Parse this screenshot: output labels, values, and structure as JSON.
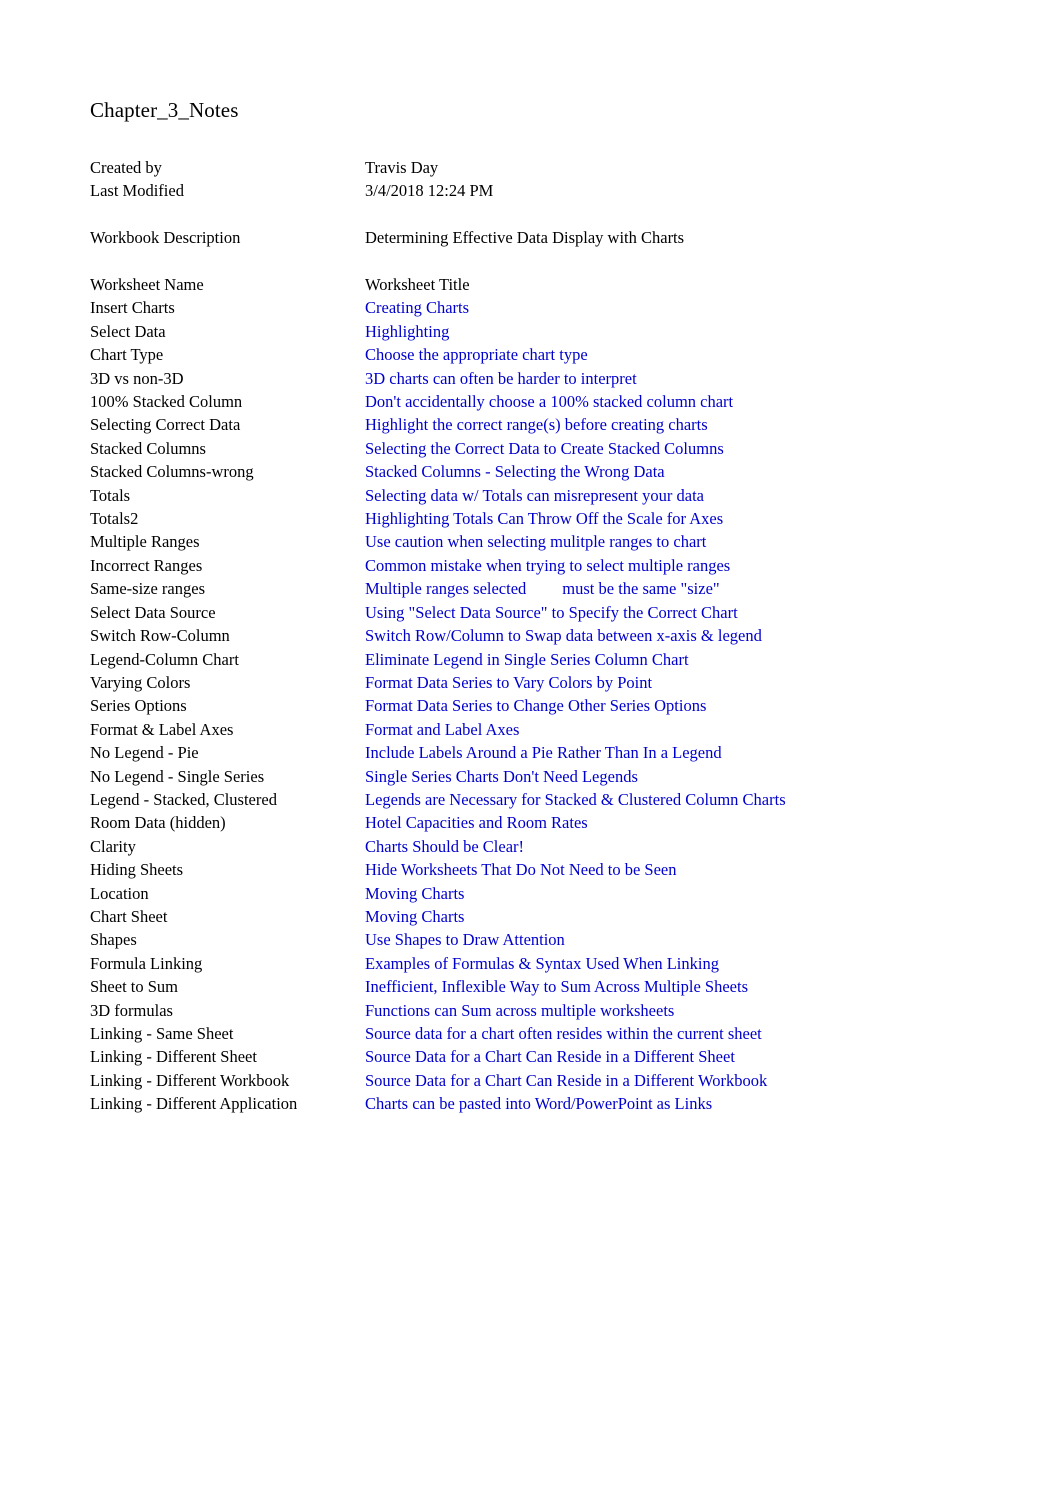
{
  "document": {
    "title": "Chapter_3_Notes",
    "metadata": [
      {
        "label": "Created by",
        "value": "Travis Day"
      },
      {
        "label": "Last Modified",
        "value": "3/4/2018 12:24 PM"
      }
    ],
    "description": {
      "label": "Workbook Description",
      "value": "Determining Effective Data Display with Charts"
    },
    "table": {
      "headers": {
        "name": "Worksheet Name",
        "title": "Worksheet Title"
      },
      "rows": [
        {
          "name": "Insert Charts",
          "title": "Creating Charts"
        },
        {
          "name": "Select Data",
          "title": "Highlighting"
        },
        {
          "name": "Chart Type",
          "title": "Choose the appropriate chart type"
        },
        {
          "name": "3D vs non-3D",
          "title": "3D charts can often be harder to interpret"
        },
        {
          "name": "100% Stacked Column",
          "title": "Don't accidentally choose a 100% stacked column chart"
        },
        {
          "name": "Selecting Correct Data",
          "title": "Highlight the correct range(s) before creating charts"
        },
        {
          "name": "Stacked Columns",
          "title": "Selecting the Correct Data to Create Stacked Columns"
        },
        {
          "name": "Stacked Columns-wrong",
          "title": "Stacked Columns - Selecting the Wrong Data"
        },
        {
          "name": "Totals",
          "title": "Selecting data w/ Totals can misrepresent your data"
        },
        {
          "name": "Totals2",
          "title": "Highlighting Totals Can Throw Off the Scale for Axes"
        },
        {
          "name": "Multiple Ranges",
          "title": "Use caution when selecting mulitple ranges to chart"
        },
        {
          "name": "Incorrect Ranges",
          "title": "Common mistake when trying to select multiple ranges"
        },
        {
          "name": "Same-size ranges",
          "title": "Multiple ranges selected",
          "title_tail": "must be the same \"size\""
        },
        {
          "name": "Select Data Source",
          "title": "Using \"Select Data Source\" to Specify the Correct Chart"
        },
        {
          "name": "Switch Row-Column",
          "title": "Switch Row/Column to Swap data between x-axis & legend"
        },
        {
          "name": "Legend-Column Chart",
          "title": "Eliminate Legend in Single Series Column Chart"
        },
        {
          "name": "Varying Colors",
          "title": "Format Data Series to Vary Colors by Point"
        },
        {
          "name": "Series Options",
          "title": "Format Data Series to Change Other Series Options"
        },
        {
          "name": "Format & Label Axes",
          "title": "Format and Label Axes"
        },
        {
          "name": "No Legend - Pie",
          "title": "Include Labels Around a Pie Rather Than In a Legend"
        },
        {
          "name": "No Legend - Single Series",
          "title": "Single Series Charts Don't Need Legends"
        },
        {
          "name": "Legend - Stacked, Clustered",
          "title": "Legends are Necessary for Stacked & Clustered Column Charts"
        },
        {
          "name": "Room Data (hidden)",
          "title": "Hotel Capacities and Room Rates"
        },
        {
          "name": "Clarity",
          "title": "Charts Should be Clear!"
        },
        {
          "name": "Hiding Sheets",
          "title": "Hide Worksheets That Do Not Need to be Seen"
        },
        {
          "name": "Location",
          "title": "Moving Charts"
        },
        {
          "name": "Chart Sheet",
          "title": "Moving Charts"
        },
        {
          "name": "Shapes",
          "title": "Use Shapes to Draw Attention"
        },
        {
          "name": "Formula Linking",
          "title": "Examples of Formulas & Syntax Used When Linking"
        },
        {
          "name": "Sheet to Sum",
          "title": "Inefficient, Inflexible Way to Sum Across Multiple Sheets"
        },
        {
          "name": "3D formulas",
          "title": "Functions can Sum across multiple worksheets"
        },
        {
          "name": "Linking - Same Sheet",
          "title": "Source data for a chart often resides within the current sheet"
        },
        {
          "name": "Linking - Different Sheet",
          "title": "Source Data for a Chart Can Reside in a Different Sheet"
        },
        {
          "name": "Linking - Different Workbook",
          "title": "Source Data for a Chart Can Reside in a Different Workbook"
        },
        {
          "name": "Linking - Different Application",
          "title": "Charts can be pasted into Word/PowerPoint as Links"
        }
      ]
    }
  },
  "colors": {
    "text": "#000000",
    "link": "#0000CC",
    "background": "#ffffff"
  }
}
